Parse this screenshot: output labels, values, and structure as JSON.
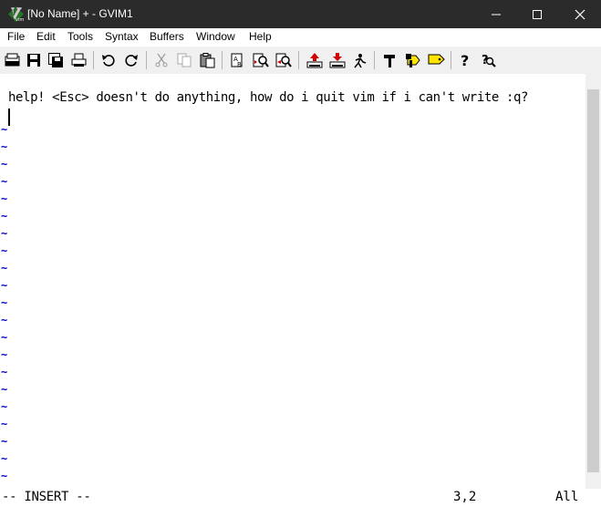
{
  "window": {
    "title": "[No Name] + - GVIM1",
    "icon": "vim-icon"
  },
  "menubar": {
    "items": [
      "File",
      "Edit",
      "Tools",
      "Syntax",
      "Buffers",
      "Window",
      "Help"
    ]
  },
  "toolbar": {
    "icons": [
      "open-icon",
      "save-icon",
      "save-all-icon",
      "print-icon",
      "undo-icon",
      "redo-icon",
      "cut-icon",
      "copy-icon",
      "paste-icon",
      "replace-icon",
      "find-next-icon",
      "find-prev-icon",
      "load-session-icon",
      "save-session-icon",
      "run-script-icon",
      "make-icon",
      "run-ctags-icon",
      "jump-tag-icon",
      "help-icon",
      "find-help-icon"
    ]
  },
  "editor": {
    "lines": [
      "help! <Esc> doesn't do anything, how do i quit vim if i can't write :q?",
      ""
    ],
    "tilde_char": "~",
    "tilde_color": "#0000c8"
  },
  "status": {
    "mode": "-- INSERT --",
    "position": "3,2",
    "scroll": "All"
  }
}
